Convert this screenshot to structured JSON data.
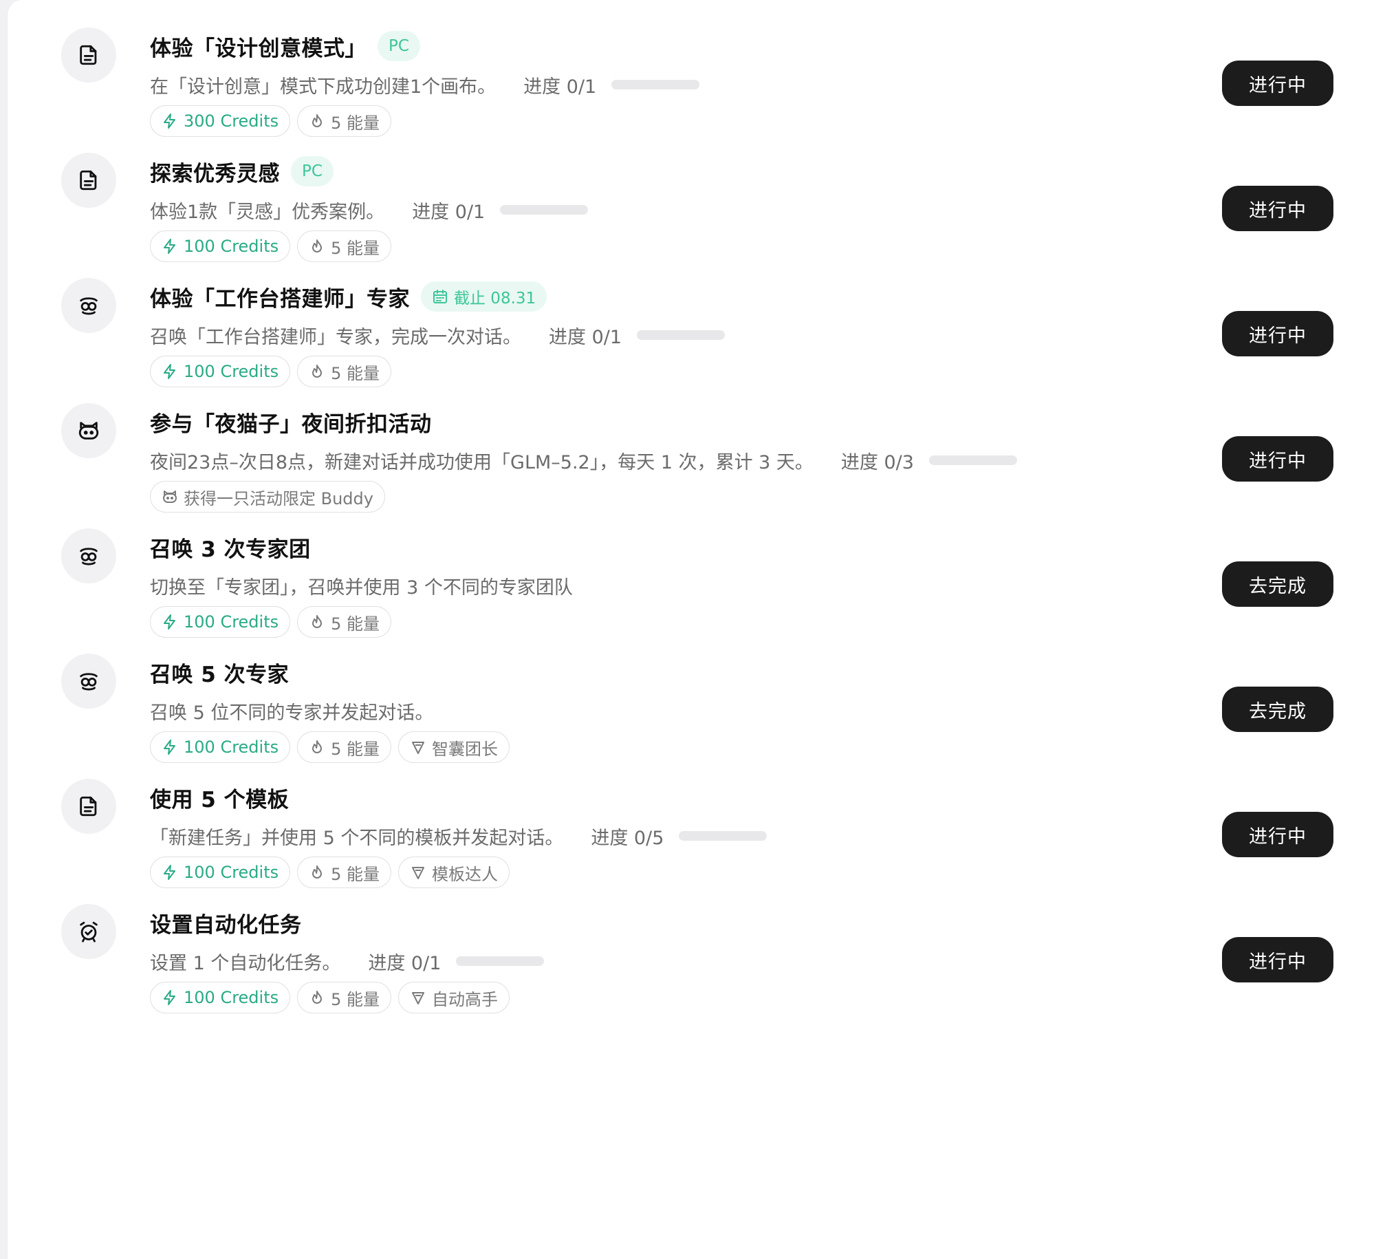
{
  "tasks": [
    {
      "icon": "document-icon",
      "title": "体验「设计创意模式」",
      "tag": {
        "type": "platform",
        "text": "PC"
      },
      "desc": "在「设计创意」模式下成功创建1个画布。",
      "progress": {
        "label": "进度 0/1",
        "value": 0
      },
      "chips": [
        {
          "type": "credits",
          "icon": "bolt-icon",
          "text": "300 Credits"
        },
        {
          "type": "energy",
          "icon": "flame-icon",
          "text": "5 能量"
        }
      ],
      "action": "进行中"
    },
    {
      "icon": "document-icon",
      "title": "探索优秀灵感",
      "tag": {
        "type": "platform",
        "text": "PC"
      },
      "desc": "体验1款「灵感」优秀案例。",
      "progress": {
        "label": "进度 0/1",
        "value": 0
      },
      "chips": [
        {
          "type": "credits",
          "icon": "bolt-icon",
          "text": "100 Credits"
        },
        {
          "type": "energy",
          "icon": "flame-icon",
          "text": "5 能量"
        }
      ],
      "action": "进行中"
    },
    {
      "icon": "expert-icon",
      "title": "体验「工作台搭建师」专家",
      "tag": {
        "type": "deadline",
        "text": "截止 08.31"
      },
      "desc": "召唤「工作台搭建师」专家，完成一次对话。",
      "progress": {
        "label": "进度 0/1",
        "value": 0
      },
      "chips": [
        {
          "type": "credits",
          "icon": "bolt-icon",
          "text": "100 Credits"
        },
        {
          "type": "energy",
          "icon": "flame-icon",
          "text": "5 能量"
        }
      ],
      "action": "进行中"
    },
    {
      "icon": "cat-icon",
      "title": "参与「夜猫子」夜间折扣活动",
      "tag": null,
      "desc": "夜间23点–次日8点，新建对话并成功使用「GLM–5.2」，每天 1 次，累计 3 天。",
      "progress": {
        "label": "进度 0/3",
        "value": 0
      },
      "chips": [
        {
          "type": "buddy",
          "icon": "cat-icon",
          "text": "获得一只活动限定 Buddy"
        }
      ],
      "action": "进行中"
    },
    {
      "icon": "expert-icon",
      "title": "召唤 3 次专家团",
      "tag": null,
      "desc": "切换至「专家团」，召唤并使用 3 个不同的专家团队",
      "progress": null,
      "chips": [
        {
          "type": "credits",
          "icon": "bolt-icon",
          "text": "100 Credits"
        },
        {
          "type": "energy",
          "icon": "flame-icon",
          "text": "5 能量"
        }
      ],
      "action": "去完成"
    },
    {
      "icon": "expert-icon",
      "title": "召唤 5 次专家",
      "tag": null,
      "desc": "召唤 5 位不同的专家并发起对话。",
      "progress": null,
      "chips": [
        {
          "type": "credits",
          "icon": "bolt-icon",
          "text": "100 Credits"
        },
        {
          "type": "energy",
          "icon": "flame-icon",
          "text": "5 能量"
        },
        {
          "type": "badge",
          "icon": "badge-icon",
          "text": "智囊团长"
        }
      ],
      "action": "去完成"
    },
    {
      "icon": "document-icon",
      "title": "使用 5 个模板",
      "tag": null,
      "desc": "「新建任务」并使用 5 个不同的模板并发起对话。",
      "progress": {
        "label": "进度 0/5",
        "value": 0
      },
      "chips": [
        {
          "type": "credits",
          "icon": "bolt-icon",
          "text": "100 Credits"
        },
        {
          "type": "energy",
          "icon": "flame-icon",
          "text": "5 能量"
        },
        {
          "type": "badge",
          "icon": "badge-icon",
          "text": "模板达人"
        }
      ],
      "action": "进行中"
    },
    {
      "icon": "alarm-clock-icon",
      "title": "设置自动化任务",
      "tag": null,
      "desc": "设置 1 个自动化任务。",
      "progress": {
        "label": "进度 0/1",
        "value": 0
      },
      "chips": [
        {
          "type": "credits",
          "icon": "bolt-icon",
          "text": "100 Credits"
        },
        {
          "type": "energy",
          "icon": "flame-icon",
          "text": "5 能量"
        },
        {
          "type": "badge",
          "icon": "badge-icon",
          "text": "自动高手"
        }
      ],
      "action": "进行中"
    }
  ],
  "colors": {
    "accent": "#3ec59a",
    "accent_text": "#2aaa86",
    "tag_bg": "#e9f8f2",
    "button_bg": "#1c1c1c",
    "muted_text": "#6b6b6b"
  }
}
